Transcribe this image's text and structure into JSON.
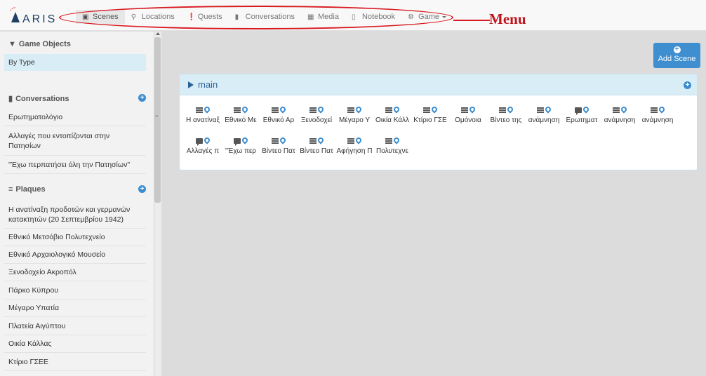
{
  "app": {
    "logo_text": "ARIS"
  },
  "nav": {
    "items": [
      {
        "label": "Scenes",
        "icon": "film-icon",
        "active": true
      },
      {
        "label": "Locations",
        "icon": "map-marker-icon",
        "active": false
      },
      {
        "label": "Quests",
        "icon": "exclamation-circle-icon",
        "active": false
      },
      {
        "label": "Conversations",
        "icon": "comment-icon",
        "active": false
      },
      {
        "label": "Media",
        "icon": "picture-icon",
        "active": false
      },
      {
        "label": "Notebook",
        "icon": "book-icon",
        "active": false
      },
      {
        "label": "Game",
        "icon": "cog-icon",
        "active": false
      }
    ],
    "annotation": "Menu"
  },
  "sidebar": {
    "game_objects": {
      "title": "Game Objects",
      "items": [
        "By Type"
      ]
    },
    "conversations": {
      "title": "Conversations",
      "items": [
        "Ερωτηματολόγιο",
        "Αλλαγές που εντοπίζονται στην Πατησίων",
        "\"Έχω περπατήσει όλη την Πατησίων\""
      ]
    },
    "plaques": {
      "title": "Plaques",
      "items": [
        "Η ανατίναξη προδοτών και γερμανών κατακτητών (20 Σεπτεμβρίου 1942)",
        "Εθνικό Μετσόβιο Πολυτεχνείο",
        "Εθνικό Αρχαιολογικό Μουσείο",
        "Ξενοδοχείο Ακροπόλ",
        "Πάρκο Κύπρου",
        "Μέγαρο Υπατία",
        "Πλατεία Αιγύπτου",
        "Οικία Κάλλας",
        "Κτίριο ΓΣΕΕ"
      ]
    }
  },
  "main": {
    "add_scene_label": "Add Scene",
    "scene": {
      "title": "main",
      "rows": [
        [
          {
            "label": "Η ανατίναξ",
            "type": "plaque"
          },
          {
            "label": "Εθνικό Με",
            "type": "plaque"
          },
          {
            "label": "Εθνικό Αρ",
            "type": "plaque"
          },
          {
            "label": "Ξενοδοχεί",
            "type": "plaque"
          },
          {
            "label": "Μέγαρο Υ",
            "type": "plaque"
          },
          {
            "label": "Οικία Κάλλ",
            "type": "plaque"
          },
          {
            "label": "Κτίριο ΓΣΕ",
            "type": "plaque"
          },
          {
            "label": "Ομόνοια",
            "type": "plaque"
          },
          {
            "label": "Βίντεο της",
            "type": "plaque"
          },
          {
            "label": "ανάμνηση",
            "type": "plaque"
          },
          {
            "label": "Ερωτηματ",
            "type": "conversation"
          },
          {
            "label": "ανάμνηση",
            "type": "plaque"
          },
          {
            "label": "ανάμνηση",
            "type": "plaque"
          }
        ],
        [
          {
            "label": "Αλλαγές π",
            "type": "conversation"
          },
          {
            "label": "\"Έχω περ",
            "type": "conversation"
          },
          {
            "label": "Βίντεο Πατ",
            "type": "plaque"
          },
          {
            "label": "Βίντεο Πατ",
            "type": "plaque"
          },
          {
            "label": "Αφήγηση Π",
            "type": "plaque"
          },
          {
            "label": "Πολυτεχνε",
            "type": "plaque"
          }
        ]
      ]
    }
  },
  "colors": {
    "accent": "#3c8dcf",
    "annotation_red": "#d71920",
    "panel_head": "#d9edf7"
  }
}
